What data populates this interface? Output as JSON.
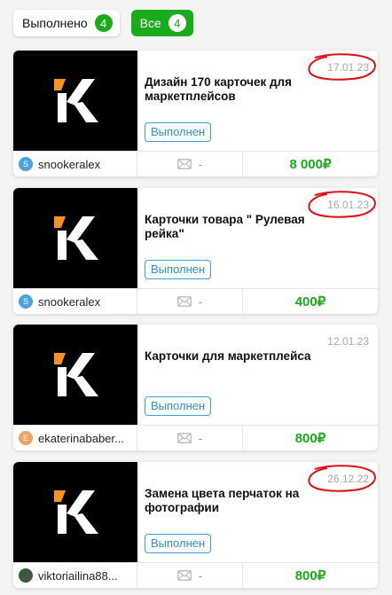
{
  "filters": [
    {
      "label": "Выполнено",
      "count": "4"
    },
    {
      "label": "Все",
      "count": "4"
    }
  ],
  "orders": [
    {
      "title": "Дизайн 170 карточек для маркетплейсов",
      "date": "17.01.23",
      "status": "Выполнен",
      "avatar_letter": "S",
      "avatar_color": "#4aa3df",
      "username": "snookeralex",
      "messages": "-",
      "price": "8 000₽",
      "date_circled": true
    },
    {
      "title": "Карточки товара \" Рулевая рейка\"",
      "date": "16.01.23",
      "status": "Выполнен",
      "avatar_letter": "S",
      "avatar_color": "#4aa3df",
      "username": "snookeralex",
      "messages": "-",
      "price": "400₽",
      "date_circled": true
    },
    {
      "title": "Карточки для маркетплейса",
      "date": "12.01.23",
      "status": "Выполнен",
      "avatar_letter": "E",
      "avatar_color": "#f0a060",
      "username": "ekaterinababer...",
      "messages": "-",
      "price": "800₽",
      "date_circled": false
    },
    {
      "title": "Замена цвета перчаток на фотографии",
      "date": "26.12.22",
      "status": "Выполнен",
      "avatar_letter": "",
      "avatar_color": "#3a5a3a",
      "username": "viktoriailina88...",
      "messages": "-",
      "price": "800₽",
      "date_circled": true
    }
  ],
  "colors": {
    "accent_green": "#1aab1a",
    "status_blue": "#2b8fd6",
    "annotation_red": "#e01010",
    "logo_orange": "#f7931e"
  },
  "icons": {
    "logo": "kwork-k-logo",
    "messages": "envelope-icon"
  }
}
